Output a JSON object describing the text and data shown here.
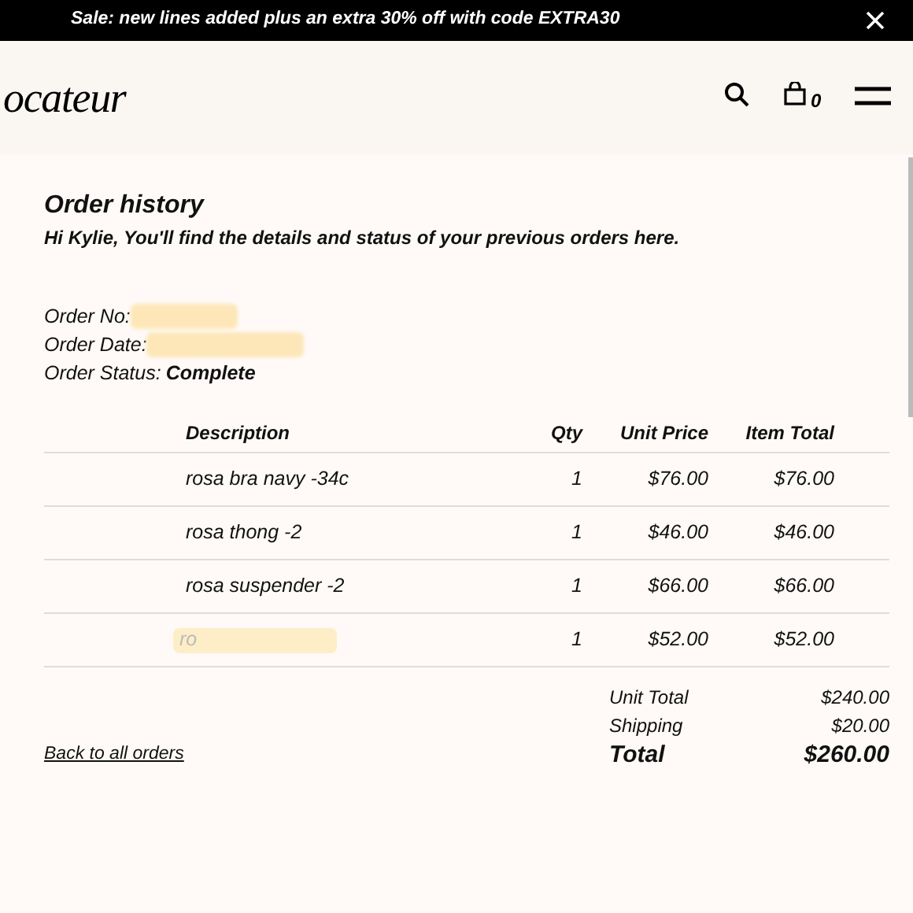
{
  "banner": {
    "text": "Sale: new lines added plus an extra 30% off with code EXTRA30"
  },
  "header": {
    "logo": "ocateur",
    "cart_count": "0"
  },
  "title": "Order history",
  "intro": "Hi Kylie, You'll find the details and status of your previous orders here.",
  "order_info": [
    {
      "label": "Order No:",
      "redacted": true
    },
    {
      "label": "Order Date:",
      "redacted": true
    },
    {
      "label": "Order Status:",
      "value": "Complete",
      "redacted": false
    }
  ],
  "table": {
    "columns": [
      "Description",
      "Qty",
      "Unit Price",
      "Item Total"
    ],
    "rows": [
      {
        "description": "rosa bra navy -34c",
        "redacted": false,
        "qty": "1",
        "unit_price": "$76.00",
        "item_total": "$76.00"
      },
      {
        "description": "rosa thong -2",
        "redacted": false,
        "qty": "1",
        "unit_price": "$46.00",
        "item_total": "$46.00"
      },
      {
        "description": "rosa suspender -2",
        "redacted": false,
        "qty": "1",
        "unit_price": "$66.00",
        "item_total": "$66.00"
      },
      {
        "description": "ro",
        "redacted": true,
        "qty": "1",
        "unit_price": "$52.00",
        "item_total": "$52.00"
      }
    ]
  },
  "totals": [
    {
      "label": "Unit Total",
      "value": "$240.00",
      "kind": "normal"
    },
    {
      "label": "Shipping",
      "value": "$20.00",
      "kind": "normal"
    },
    {
      "label": "Total",
      "value": "$260.00",
      "kind": "grand"
    }
  ],
  "back_link": "Back to all orders"
}
